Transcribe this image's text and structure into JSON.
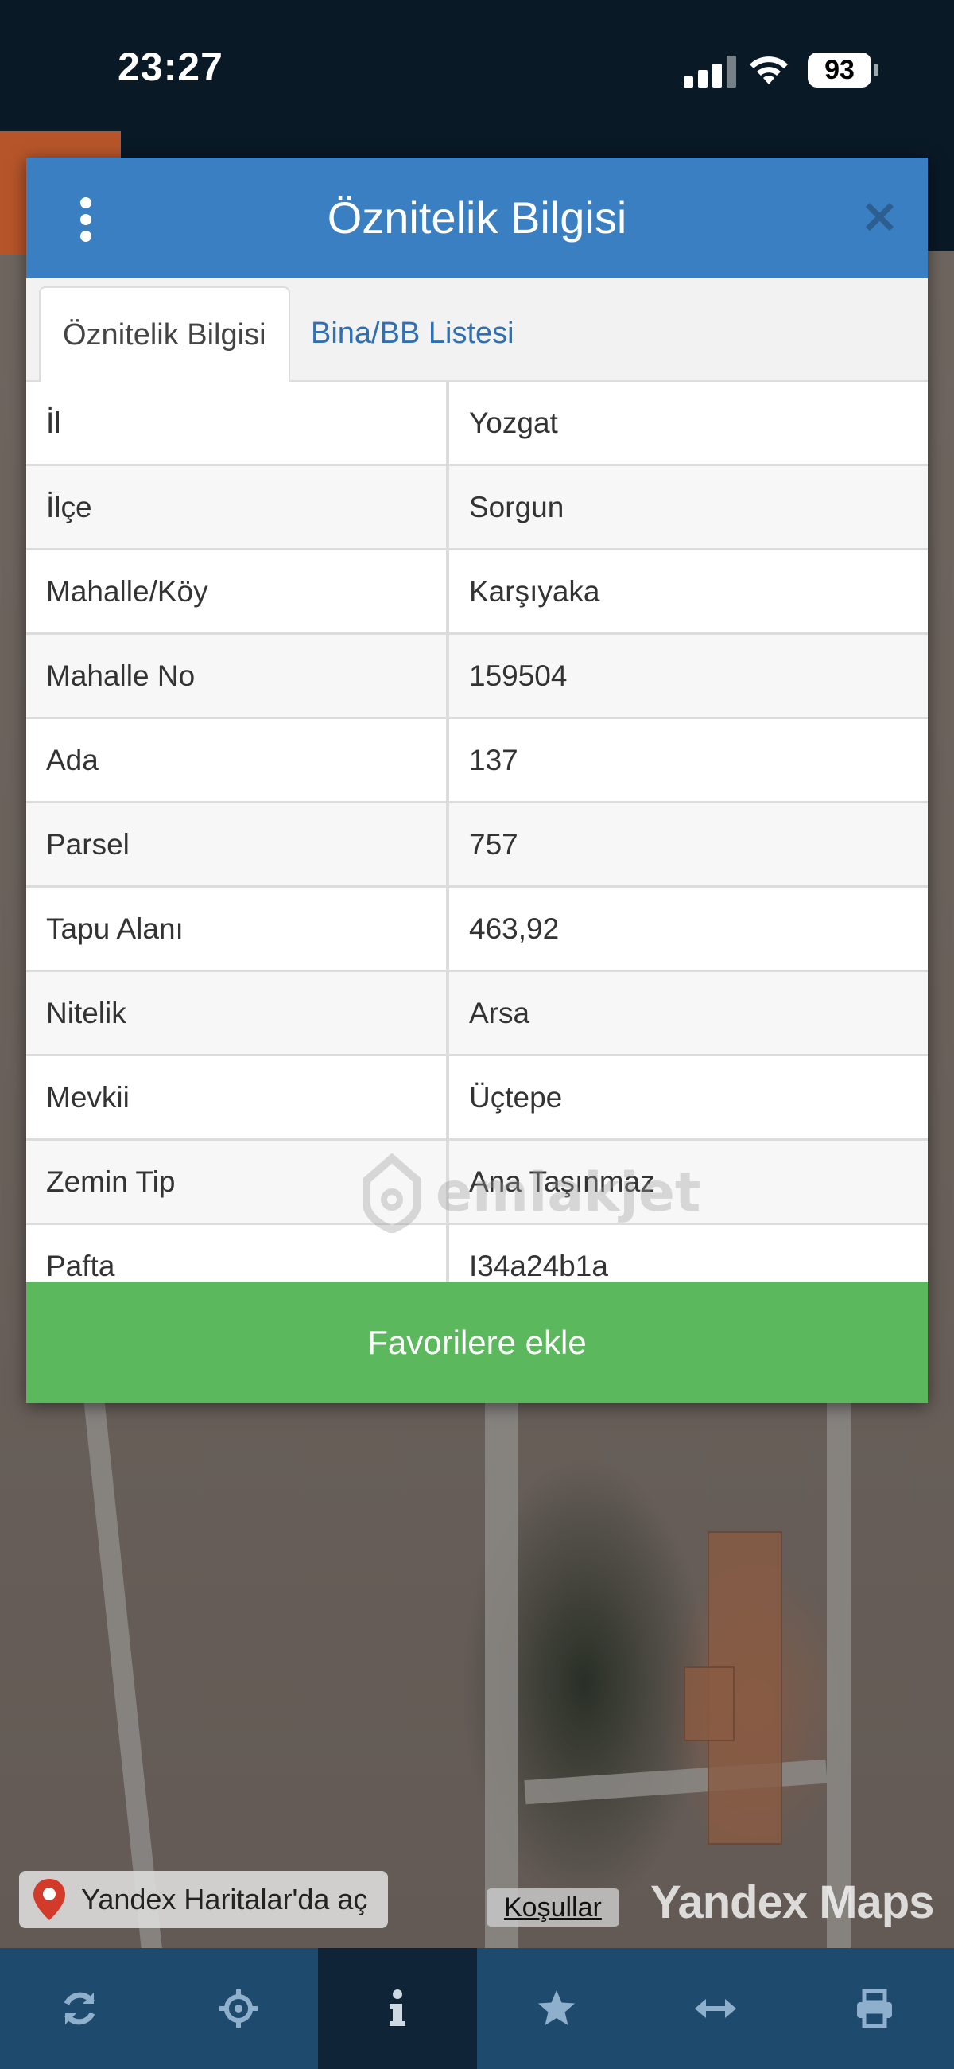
{
  "status_bar": {
    "time": "23:27",
    "battery": "93"
  },
  "dialog": {
    "title": "Öznitelik Bilgisi",
    "close_icon": "close-icon",
    "menu_icon": "kebab-menu-icon",
    "tabs": [
      {
        "label": "Öznitelik Bilgisi",
        "active": true
      },
      {
        "label": "Bina/BB Listesi",
        "active": false
      }
    ],
    "rows": [
      {
        "key": "İl",
        "value": "Yozgat"
      },
      {
        "key": "İlçe",
        "value": "Sorgun"
      },
      {
        "key": "Mahalle/Köy",
        "value": "Karşıyaka"
      },
      {
        "key": "Mahalle No",
        "value": "159504"
      },
      {
        "key": "Ada",
        "value": "137"
      },
      {
        "key": "Parsel",
        "value": "757"
      },
      {
        "key": "Tapu Alanı",
        "value": "463,92"
      },
      {
        "key": "Nitelik",
        "value": "Arsa"
      },
      {
        "key": "Mevkii",
        "value": "Üçtepe"
      },
      {
        "key": "Zemin Tip",
        "value": "Ana Taşınmaz"
      },
      {
        "key": "Pafta",
        "value": "I34a24b1a"
      }
    ],
    "favorite_button": "Favorilere ekle"
  },
  "watermark": "emlakjet",
  "map": {
    "open_yandex_label": "Yandex Haritalar'da aç",
    "terms_label": "Koşullar",
    "logo_text": "Yandex Maps"
  },
  "toolbar": {
    "icons": [
      "refresh-icon",
      "crosshair-icon",
      "info-icon",
      "star-icon",
      "measure-icon",
      "print-icon"
    ],
    "active_index": 2
  },
  "colors": {
    "header_blue": "#3a7fc1",
    "favorite_green": "#5cb85c",
    "toolbar_blue": "#1e4a6e",
    "toolbar_active": "#0f2436"
  }
}
